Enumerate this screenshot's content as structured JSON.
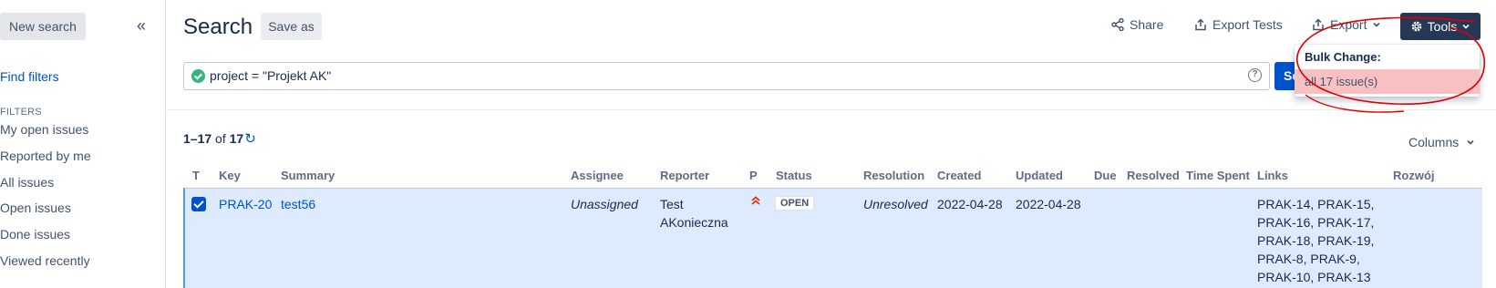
{
  "sidebar": {
    "new_search": "New search",
    "collapse_glyph": "«",
    "find_filters": "Find filters",
    "filters_heading": "FILTERS",
    "items": [
      {
        "label": "My open issues"
      },
      {
        "label": "Reported by me"
      },
      {
        "label": "All issues"
      },
      {
        "label": "Open issues"
      },
      {
        "label": "Done issues"
      },
      {
        "label": "Viewed recently"
      }
    ]
  },
  "header": {
    "title": "Search",
    "save_as": "Save as",
    "share": "Share",
    "export_tests": "Export Tests",
    "export": "Export",
    "tools": "Tools"
  },
  "search": {
    "jql": "project = \"Projekt AK\"",
    "help_glyph": "?",
    "button_label": "Search"
  },
  "results": {
    "range": "1–17",
    "of": " of ",
    "total": "17",
    "columns_label": "Columns"
  },
  "table": {
    "headers": [
      "T",
      "Key",
      "Summary",
      "Assignee",
      "Reporter",
      "P",
      "Status",
      "Resolution",
      "Created",
      "Updated",
      "Due",
      "Resolved",
      "Time Spent",
      "Links",
      "Rozwój"
    ],
    "row": {
      "key": "PRAK-20",
      "summary": "test56",
      "assignee": "Unassigned",
      "reporter_line1": "Test",
      "reporter_line2": "AKonieczna",
      "priority_glyph": "︽",
      "status": "OPEN",
      "resolution": "Unresolved",
      "created": "2022-04-28",
      "updated": "2022-04-28",
      "links": [
        "PRAK-14, PRAK-15,",
        "PRAK-16, PRAK-17,",
        "PRAK-18, PRAK-19,",
        "PRAK-8, PRAK-9,",
        "PRAK-10, PRAK-13"
      ],
      "selected": true
    }
  },
  "tools_menu": {
    "heading": "Bulk Change:",
    "item": "all 17 issue(s)"
  },
  "colors": {
    "accent": "#0052cc",
    "tools_bg": "#253858",
    "row_selected": "#deebff",
    "menu_highlight": "#f7c1c1",
    "annotation": "#e00000",
    "status_ok": "#36b37e",
    "priority": "#de350b"
  }
}
